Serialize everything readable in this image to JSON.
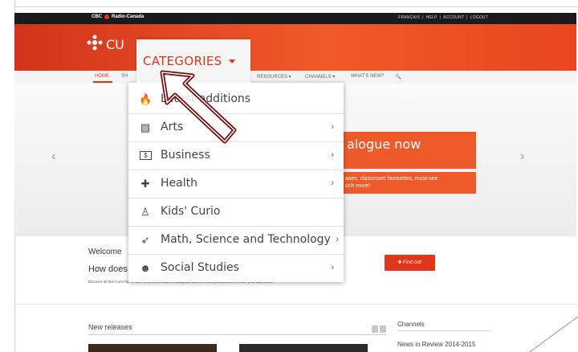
{
  "topbar": {
    "cbc": "CBC",
    "radio_canada": "Radio-Canada",
    "links": [
      "FRANÇAIS",
      "|",
      "HELP",
      "|",
      "ACCOUNT",
      "|",
      "LOGOUT"
    ]
  },
  "header": {
    "brand": "CU"
  },
  "nav": {
    "home": "HOME",
    "sh": "SH",
    "resources": "RESOURCES ▾",
    "channels": "CHANNELS ▾",
    "whats_new": "WHAT'S NEW?",
    "search": "🔍"
  },
  "categories": {
    "label": "CATEGORIES",
    "items": [
      {
        "label": "Latest additions",
        "icon": "flame-icon",
        "glyph": "🔥",
        "chevron": ""
      },
      {
        "label": "Arts",
        "icon": "picture-icon",
        "glyph": "▨",
        "chevron": "›"
      },
      {
        "label": "Business",
        "icon": "money-icon",
        "glyph": "$",
        "chevron": "›"
      },
      {
        "label": "Health",
        "icon": "medkit-icon",
        "glyph": "✚",
        "chevron": "›"
      },
      {
        "label": "Kids' Curio",
        "icon": "child-icon",
        "glyph": "♙",
        "chevron": ""
      },
      {
        "label": "Math, Science and Technology",
        "icon": "rocket-icon",
        "glyph": "➶",
        "chevron": "›"
      },
      {
        "label": "Social Studies",
        "icon": "group-icon",
        "glyph": "☻",
        "chevron": "›"
      }
    ]
  },
  "slider": {
    "promo_title": "alogue now",
    "promo_sub_1": "ases, classroom favourites, must-see",
    "promo_sub_2": "uch more!",
    "prev": "‹",
    "next": "›"
  },
  "welcome": {
    "title": "Welcome",
    "how": "How does",
    "text": "Discover all that Curio has to offer in this short video. Navigation and the many possibilities to make your day easier!",
    "find_out": "Find out!"
  },
  "new_releases": {
    "title": "New releases"
  },
  "channels_panel": {
    "title": "Channels",
    "first": "News in Review 2014-2015"
  },
  "colors": {
    "accent": "#e2361b",
    "header": "#f05a2a"
  }
}
